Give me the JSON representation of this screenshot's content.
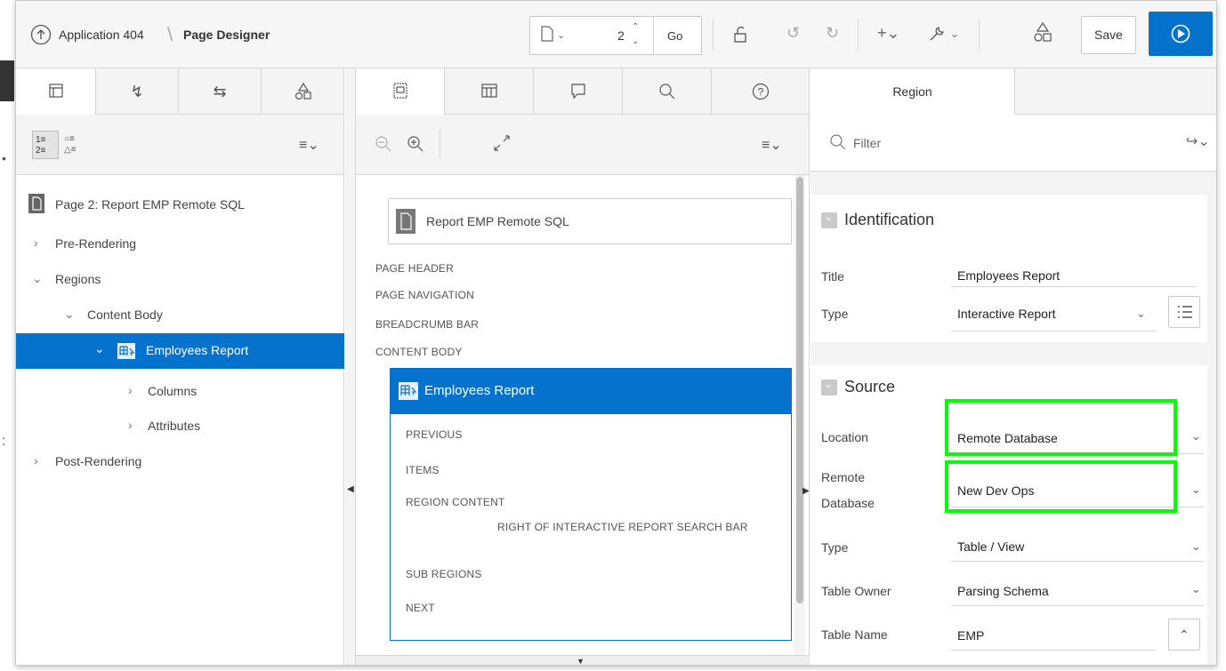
{
  "header": {
    "app_label": "Application 404",
    "breadcrumb_sep": "\\",
    "page_designer": "Page Designer",
    "page_number": "2",
    "go": "Go",
    "save": "Save"
  },
  "left_panel": {
    "page_title": "Page 2: Report EMP Remote SQL",
    "tree": {
      "pre_rendering": "Pre-Rendering",
      "regions": "Regions",
      "content_body": "Content Body",
      "employees_report": "Employees Report",
      "columns": "Columns",
      "attributes": "Attributes",
      "post_rendering": "Post-Rendering"
    },
    "list_order": "1≡\n2≡"
  },
  "layout": {
    "page_card": "Report EMP Remote SQL",
    "slots": [
      "PAGE HEADER",
      "PAGE NAVIGATION",
      "BREADCRUMB BAR",
      "CONTENT BODY"
    ],
    "region_title": "Employees Report",
    "region_slots": {
      "previous": "PREVIOUS",
      "items": "ITEMS",
      "region_content": "REGION CONTENT",
      "right_of_search": "RIGHT OF INTERACTIVE REPORT SEARCH BAR",
      "sub_regions": "SUB REGIONS",
      "next": "NEXT"
    }
  },
  "properties": {
    "tab": "Region",
    "filter_placeholder": "Filter",
    "identification": {
      "heading": "Identification",
      "title_label": "Title",
      "title_value": "Employees Report",
      "type_label": "Type",
      "type_value": "Interactive Report"
    },
    "source": {
      "heading": "Source",
      "location_label": "Location",
      "location_value": "Remote Database",
      "remote_label_1": "Remote",
      "remote_label_2": "Database",
      "remote_value": "New Dev Ops",
      "type_label": "Type",
      "type_value": "Table / View",
      "owner_label": "Table Owner",
      "owner_value": "Parsing Schema",
      "table_label": "Table Name",
      "table_value": "EMP"
    }
  },
  "colors": {
    "accent": "#0572ce",
    "highlight": "#00ff00"
  }
}
